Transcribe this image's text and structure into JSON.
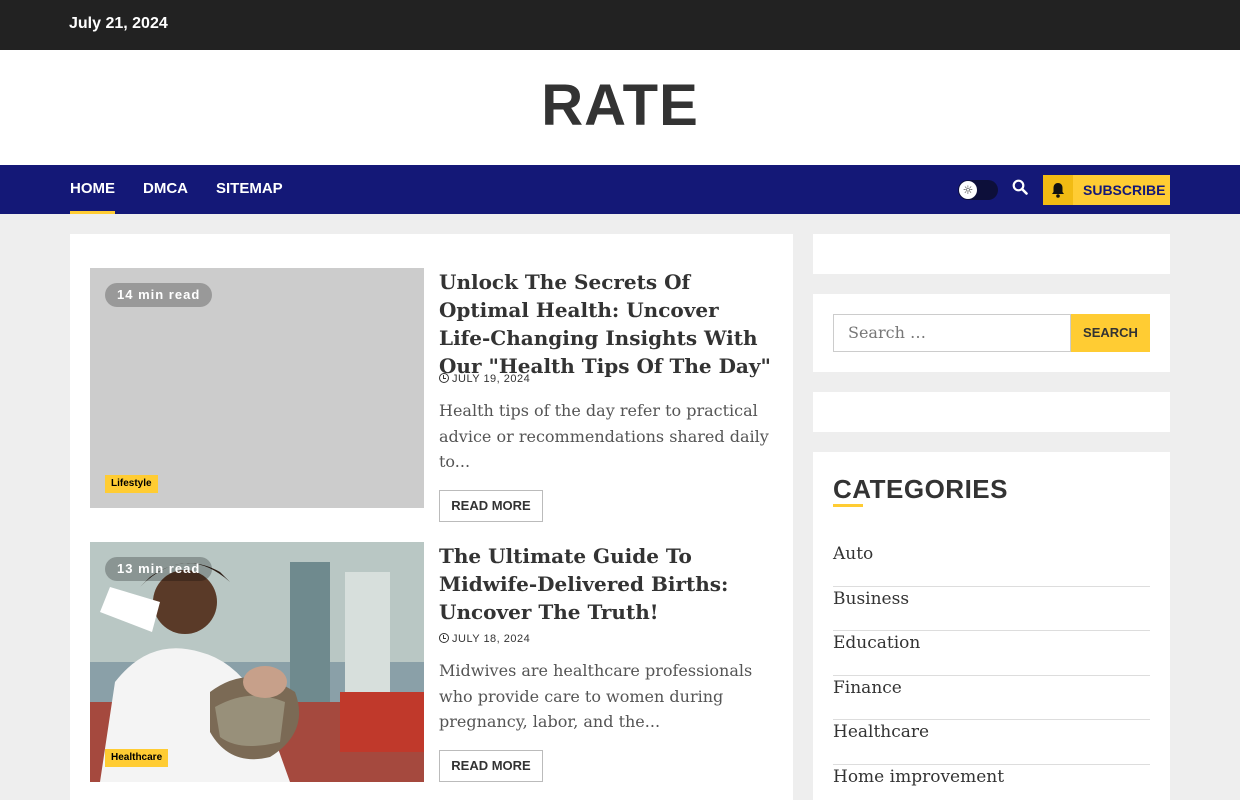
{
  "topbar": {
    "date": "July 21, 2024"
  },
  "header": {
    "site_title": "RATE"
  },
  "nav": {
    "items": [
      {
        "label": "HOME",
        "active": true
      },
      {
        "label": "DMCA",
        "active": false
      },
      {
        "label": "SITEMAP",
        "active": false
      }
    ],
    "subscribe_label": "SUBSCRIBE",
    "icons": {
      "theme_toggle": "sun-icon",
      "search": "search-icon",
      "subscribe": "bell-icon"
    }
  },
  "posts": [
    {
      "read_time": "14 min read",
      "category": "Lifestyle",
      "title": "Unlock The Secrets Of Optimal Health: Uncover Life-Changing Insights With Our \"Health Tips Of The Day\"",
      "date": "JULY 19, 2024",
      "excerpt": "Health tips of the day refer to practical advice or recommendations shared daily to...",
      "read_more": "READ MORE"
    },
    {
      "read_time": "13 min read",
      "category": "Healthcare",
      "title": "The Ultimate Guide To Midwife-Delivered Births: Uncover The Truth!",
      "date": "JULY 18, 2024",
      "excerpt": "Midwives are healthcare professionals who provide care to women during pregnancy, labor, and the...",
      "read_more": "READ MORE"
    }
  ],
  "sidebar": {
    "search": {
      "placeholder": "Search …",
      "button_label": "SEARCH"
    },
    "categories": {
      "heading": "CATEGORIES",
      "items": [
        "Auto",
        "Business",
        "Education",
        "Finance",
        "Healthcare",
        "Home improvement"
      ]
    }
  },
  "colors": {
    "accent": "#ffcc33",
    "nav_bg": "#141877",
    "topbar_bg": "#222222"
  }
}
